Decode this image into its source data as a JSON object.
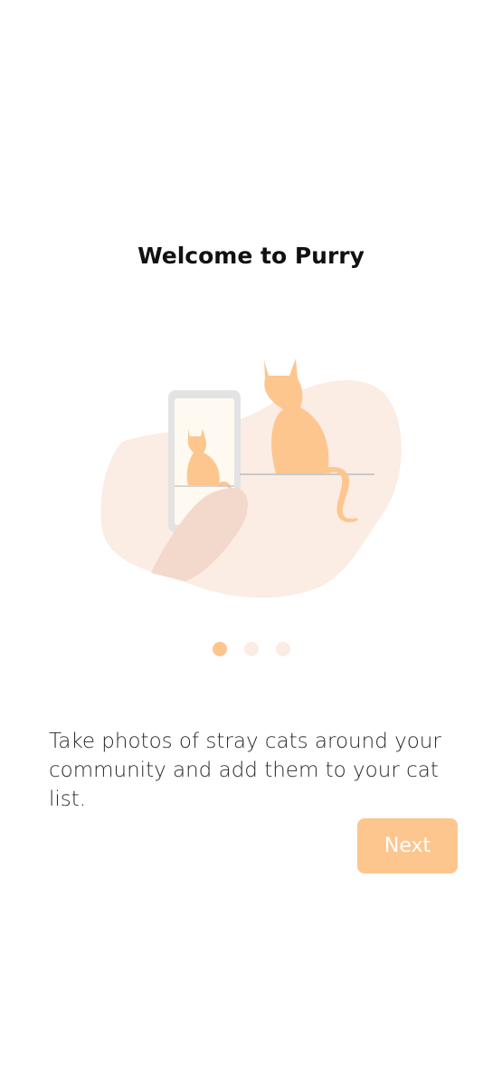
{
  "onboarding": {
    "title": "Welcome to Purry",
    "description": "Take photos of stray cats around your community and add them to your cat list.",
    "next_label": "Next",
    "illustration": "cat-photo-illustration",
    "pagination": {
      "current": 1,
      "total": 3
    }
  },
  "colors": {
    "accent": "#fdc68f",
    "blob": "#fbece4",
    "hand": "#f3d8cc",
    "dot_inactive": "#fbece4",
    "phone_frame": "#e2e2e2"
  }
}
